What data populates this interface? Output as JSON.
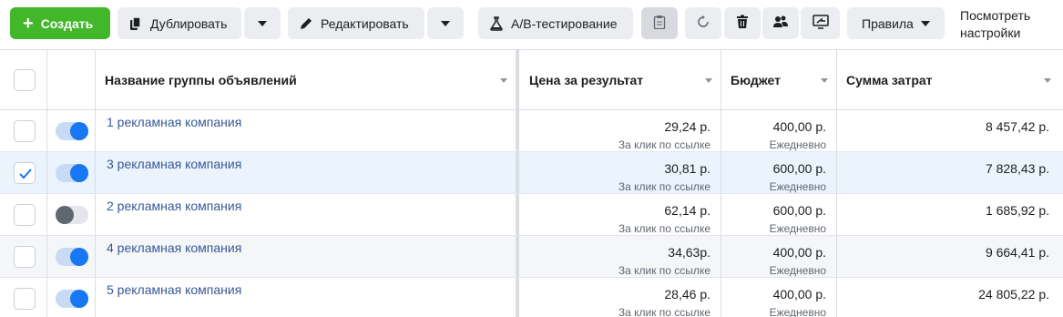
{
  "toolbar": {
    "create_label": "Создать",
    "duplicate_label": "Дублировать",
    "edit_label": "Редактировать",
    "ab_test_label": "A/B-тестирование",
    "rules_label": "Правила",
    "view_settings_label": "Посмотреть настройки"
  },
  "table": {
    "columns": {
      "name": "Название группы объявлений",
      "cost_per_result": "Цена за результат",
      "budget": "Бюджет",
      "amount_spent": "Сумма затрат"
    },
    "rows": [
      {
        "name": "1 рекламная компания",
        "selected": false,
        "active": true,
        "cost": "29,24 р.",
        "cost_type": "За клик по ссылке",
        "budget": "400,00 р.",
        "budget_period": "Ежедневно",
        "spent": "8 457,42 р."
      },
      {
        "name": "3 рекламная компания",
        "selected": true,
        "active": true,
        "cost": "30,81 р.",
        "cost_type": "За клик по ссылке",
        "budget": "600,00 р.",
        "budget_period": "Ежедневно",
        "spent": "7 828,43 р."
      },
      {
        "name": "2 рекламная компания",
        "selected": false,
        "active": false,
        "cost": "62,14 р.",
        "cost_type": "За клик по ссылке",
        "budget": "600,00 р.",
        "budget_period": "Ежедневно",
        "spent": "1 685,92 р."
      },
      {
        "name": "4 рекламная компания",
        "selected": false,
        "active": true,
        "cost": "34,63р.",
        "cost_type": "За клик по ссылке",
        "budget": "400,00 р.",
        "budget_period": "Ежедневно",
        "spent": "9 664,41 р."
      },
      {
        "name": "5 рекламная компания",
        "selected": false,
        "active": true,
        "cost": "28,46 р.",
        "cost_type": "За клик по ссылке",
        "budget": "400,00 р.",
        "budget_period": "Ежедневно",
        "spent": "24 805,22 р."
      }
    ]
  },
  "colors": {
    "create_button": "#42b72a",
    "link": "#385898",
    "toggle_on": "#1877f2",
    "selected_row": "#ebf3fc"
  },
  "icons": [
    "plus-icon",
    "duplicate-icon",
    "pencil-icon",
    "flask-icon",
    "clipboard-icon",
    "refresh-icon",
    "trash-icon",
    "people-icon",
    "share-icon",
    "chevron-down-icon",
    "checkmark-icon"
  ]
}
